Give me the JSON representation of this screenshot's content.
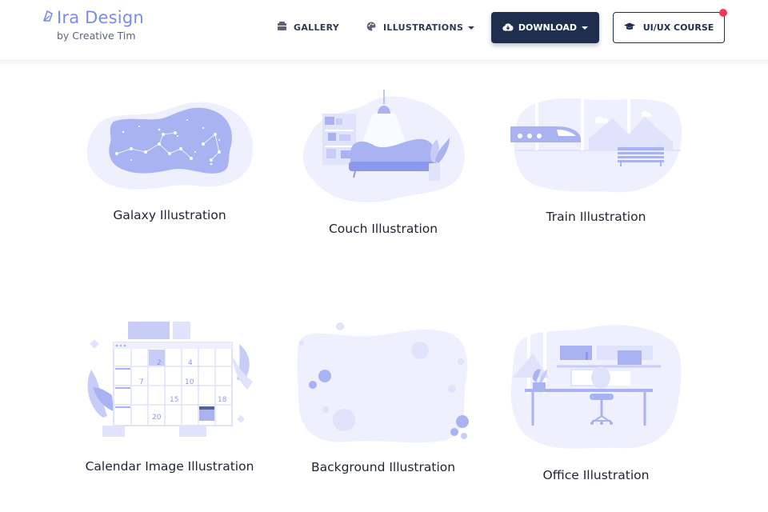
{
  "brand": {
    "title": "Ira Design",
    "subtitle": "by Creative Tim",
    "icon": "ira-logo-icon"
  },
  "nav": {
    "gallery": {
      "label": "GALLERY",
      "icon": "gallery-icon"
    },
    "illustrations": {
      "label": "ILLUSTRATIONS",
      "icon": "palette-icon"
    },
    "download": {
      "label": "DOWNLOAD",
      "icon": "cloud-download-icon"
    },
    "course": {
      "label": "UI/UX COURSE",
      "icon": "graduation-cap-icon"
    }
  },
  "cards": [
    {
      "caption": "Galaxy Illustration"
    },
    {
      "caption": "Couch Illustration"
    },
    {
      "caption": "Train Illustration"
    },
    {
      "caption": "Calendar Image Illustration"
    },
    {
      "caption": "Background Illustration"
    },
    {
      "caption": "Office Illustration"
    }
  ],
  "calendar_numbers": [
    "2",
    "4",
    "7",
    "10",
    "15",
    "18",
    "20"
  ],
  "colors": {
    "accent": "#7b8ce6",
    "dark_navy": "#1f2d4e",
    "pale": "#eef0fd",
    "light": "#dfe3fb",
    "notification": "#f5365c"
  }
}
